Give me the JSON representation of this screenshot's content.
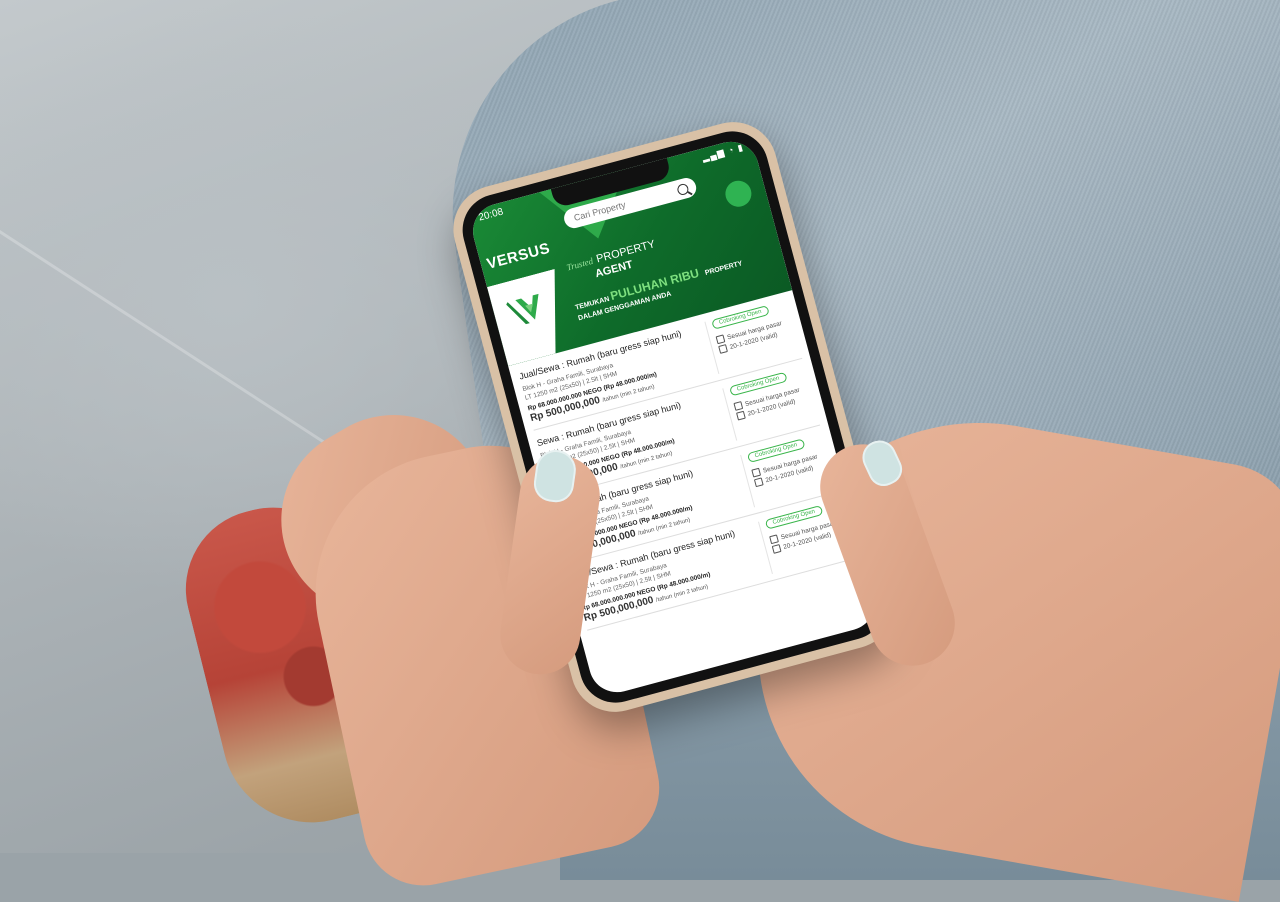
{
  "status_bar": {
    "time": "20:08",
    "signal": "▂▄▆ ◔ ▮"
  },
  "app": {
    "brand": "VERSUS"
  },
  "search": {
    "placeholder": "Cari Property"
  },
  "banner": {
    "trusted": "Trusted",
    "property": "PROPERTY",
    "agent": "AGENT",
    "tag_prefix": "TEMUKAN",
    "tag_highlight": "PULUHAN RIBU",
    "tag_property": "PROPERTY",
    "tag_line2": "DALAM GENGGAMAN ANDA"
  },
  "listings": [
    {
      "title": "Jual/Sewa : Rumah (baru gress siap huni)",
      "address": "Blok H - Graha Famili, Surabaya",
      "spec": "LT 1250 m2 (25x50) | 2.5lt | SHM",
      "price": "Rp 68.000.000.000 NEGO (Rp 48.000.000/m)",
      "rent": "Rp 500,000,000",
      "rent_period": "/tahun (min 2 tahun)",
      "badge": "Cobroking Open",
      "fee": "Sesuai harga pasar",
      "date": "20-1-2020 (valid)"
    },
    {
      "title": "Sewa : Rumah (baru gress siap huni)",
      "address": "Blok H - Graha Famili, Surabaya",
      "spec": "LT 1250 m2 (25x50) | 2.5lt | SHM",
      "price": "Rp 68.000.000.000 NEGO (Rp 48.000.000/m)",
      "rent": "Rp 500,000,000",
      "rent_period": "/tahun (min 2 tahun)",
      "badge": "Cobroking Open",
      "fee": "Sesuai harga pasar",
      "date": "20-1-2020 (valid)"
    },
    {
      "title": "Jual : Rumah (baru gress siap huni)",
      "address": "Blok H - Graha Famili, Surabaya",
      "spec": "LT 1250 m2 (25x50) | 2.5lt | SHM",
      "price": "Rp 68.000.000.000 NEGO (Rp 48.000.000/m)",
      "rent": "Rp 500,000,000",
      "rent_period": "/tahun (min 2 tahun)",
      "badge": "Cobroking Open",
      "fee": "Sesuai harga pasar",
      "date": "20-1-2020 (valid)"
    },
    {
      "title": "Jual/Sewa : Rumah (baru gress siap huni)",
      "address": "Blok H - Graha Famili, Surabaya",
      "spec": "LT 1250 m2 (25x50) | 2.5lt | SHM",
      "price": "Rp 68.000.000.000 NEGO (Rp 48.000.000/m)",
      "rent": "Rp 500,000,000",
      "rent_period": "/tahun (min 2 tahun)",
      "badge": "Cobroking Open",
      "fee": "Sesuai harga pasar",
      "date": "20-1-2020 (valid)"
    }
  ],
  "colors": {
    "brand_green": "#0e6b2a",
    "accent_green": "#39b54a",
    "case": "#d9c1a6"
  }
}
